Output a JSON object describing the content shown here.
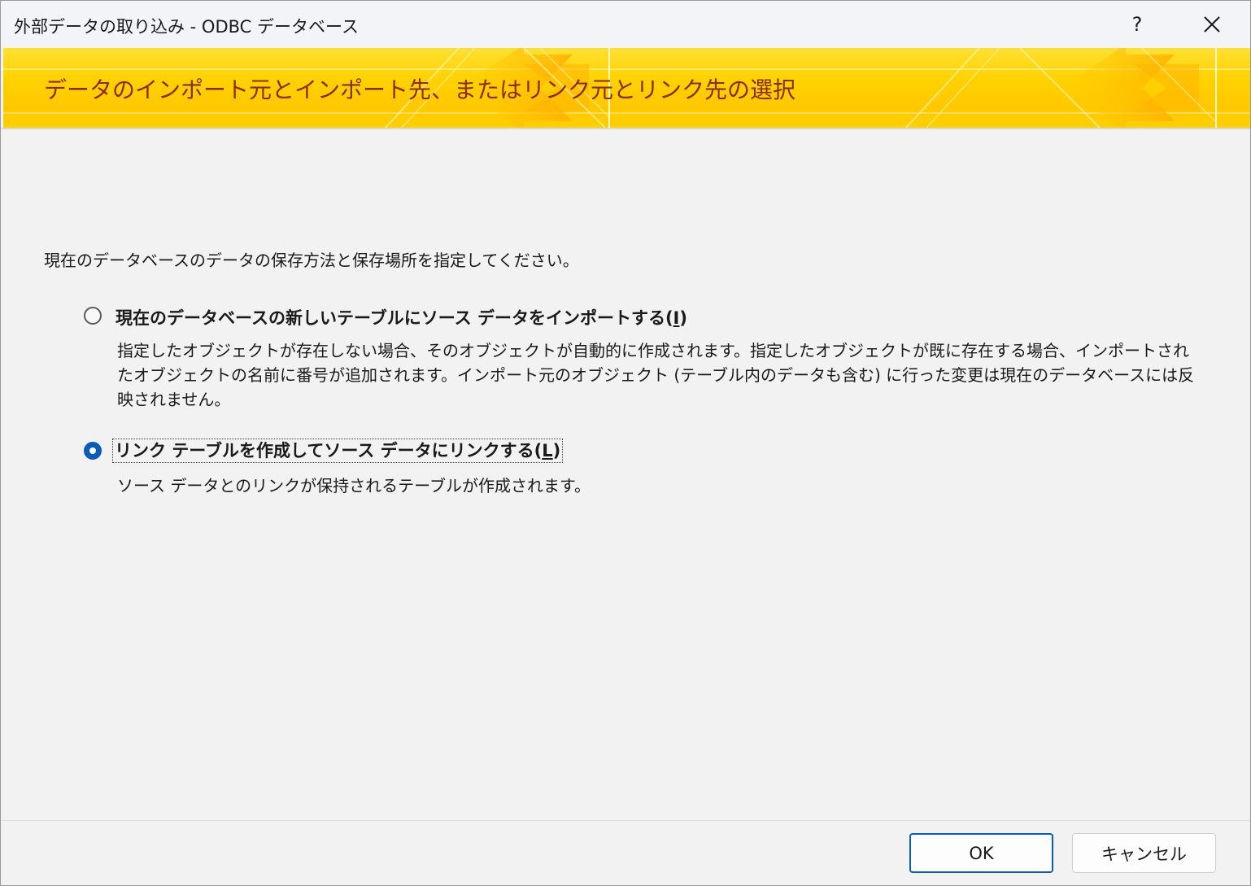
{
  "window": {
    "title": "外部データの取り込み - ODBC データベース",
    "help_label": "?"
  },
  "banner": {
    "heading": "データのインポート元とインポート先、またはリンク元とリンク先の選択",
    "colors": {
      "base": "#ffd100",
      "text": "#8b2d00"
    }
  },
  "main": {
    "instruction": "現在のデータベースのデータの保存方法と保存場所を指定してください。",
    "options": [
      {
        "label_prefix": "現在のデータベースの新しいテーブルにソース データをインポートする(",
        "accel": "I",
        "label_suffix": ")",
        "description": "指定したオブジェクトが存在しない場合、そのオブジェクトが自動的に作成されます。指定したオブジェクトが既に存在する場合、インポートされたオブジェクトの名前に番号が追加されます。インポート元のオブジェクト (テーブル内のデータも含む) に行った変更は現在のデータベースには反映されません。",
        "selected": false
      },
      {
        "label_prefix": "リンク テーブルを作成してソース データにリンクする(",
        "accel": "L",
        "label_suffix": ")",
        "description": "ソース データとのリンクが保持されるテーブルが作成されます。",
        "selected": true
      }
    ]
  },
  "footer": {
    "ok_label": "OK",
    "cancel_label": "キャンセル"
  },
  "colors": {
    "accent": "#0a5cb8"
  }
}
